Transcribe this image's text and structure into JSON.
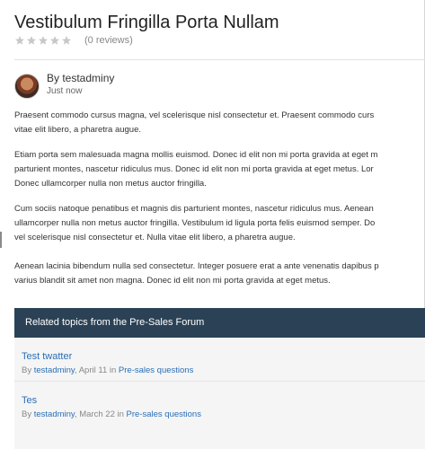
{
  "product": {
    "title": "Vestibulum Fringilla Porta Nullam",
    "rating_stars": 0,
    "rating_max": 5,
    "reviews_text": "(0 reviews)"
  },
  "author": {
    "by_label": "By testadminy",
    "time": "Just now"
  },
  "paragraphs": [
    {
      "lines": [
        "Praesent commodo cursus magna, vel scelerisque nisl consectetur et. Praesent commodo curs",
        "vitae elit libero, a pharetra augue."
      ]
    },
    {
      "lines": [
        "Etiam porta sem malesuada magna mollis euismod. Donec id elit non mi porta gravida at eget m",
        "parturient montes, nascetur ridiculus mus. Donec id elit non mi porta gravida at eget metus. Lor",
        "Donec ullamcorper nulla non metus auctor fringilla."
      ]
    },
    {
      "lines": [
        "Cum sociis natoque penatibus et magnis dis parturient montes, nascetur ridiculus mus. Aenean",
        "ullamcorper nulla non metus auctor fringilla. Vestibulum id ligula porta felis euismod semper. Do",
        "vel scelerisque nisl consectetur et. Nulla vitae elit libero, a pharetra augue."
      ]
    },
    {
      "lines": [
        "Aenean lacinia bibendum nulla sed consectetur. Integer posuere erat a ante venenatis dapibus p",
        "varius blandit sit amet non magna. Donec id elit non mi porta gravida at eget metus."
      ]
    }
  ],
  "forum": {
    "heading": "Related topics from the Pre-Sales Forum",
    "topics": [
      {
        "title": "Test twatter",
        "by": "By",
        "user": "testadminy",
        "date_in": ", April 11 in",
        "category": "Pre-sales questions"
      },
      {
        "title": "Tes",
        "by": "By",
        "user": "testadminy",
        "date_in": ", March 22 in",
        "category": "Pre-sales questions"
      }
    ]
  },
  "colors": {
    "forum_header_bg": "#2b4256",
    "link": "#2a6fb6",
    "star_empty": "#c8c8c8"
  },
  "icons": {
    "star": "star-icon"
  }
}
